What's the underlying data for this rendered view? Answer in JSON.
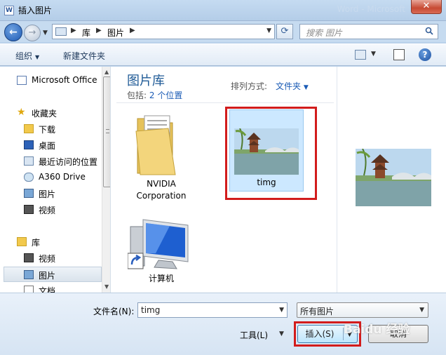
{
  "window": {
    "title": "插入图片",
    "app_icon_text": "W",
    "ghost_title": "Word - Microsoft",
    "close_label": "✕"
  },
  "nav": {
    "crumbs": [
      "库",
      "图片"
    ],
    "search_placeholder": "搜索 图片"
  },
  "toolbar": {
    "organize": "组织",
    "new_folder": "新建文件夹"
  },
  "sidebar": {
    "items": [
      {
        "label": "Microsoft Office",
        "icon": "word-doc-icon"
      },
      {
        "label": "收藏夹",
        "icon": "star-icon"
      },
      {
        "label": "下载",
        "icon": "download-folder-icon"
      },
      {
        "label": "桌面",
        "icon": "desktop-icon"
      },
      {
        "label": "最近访问的位置",
        "icon": "recent-places-icon"
      },
      {
        "label": "A360 Drive",
        "icon": "cloud-drive-icon"
      },
      {
        "label": "图片",
        "icon": "pictures-icon"
      },
      {
        "label": "视频",
        "icon": "videos-icon"
      },
      {
        "label": "库",
        "icon": "library-icon"
      },
      {
        "label": "视频",
        "icon": "videos-icon"
      },
      {
        "label": "图片",
        "icon": "pictures-icon"
      },
      {
        "label": "文档",
        "icon": "documents-icon"
      }
    ]
  },
  "content": {
    "library_title": "图片库",
    "includes_prefix": "包括:",
    "includes_link": "2 个位置",
    "arrange_label": "排列方式:",
    "arrange_value": "文件夹",
    "files": [
      {
        "name_line1": "NVIDIA",
        "name_line2": "Corporation",
        "type": "folder"
      },
      {
        "name_line1": "timg",
        "name_line2": "",
        "type": "image",
        "selected": true
      },
      {
        "name_line1": "计算机",
        "name_line2": "",
        "type": "shortcut"
      }
    ]
  },
  "bottom": {
    "filename_label": "文件名(N):",
    "filename_value": "timg",
    "filetype_value": "所有图片",
    "tools_label": "工具(L)",
    "insert_label": "插入(S)",
    "cancel_label": "取消",
    "watermark": "Baidu 经验"
  }
}
